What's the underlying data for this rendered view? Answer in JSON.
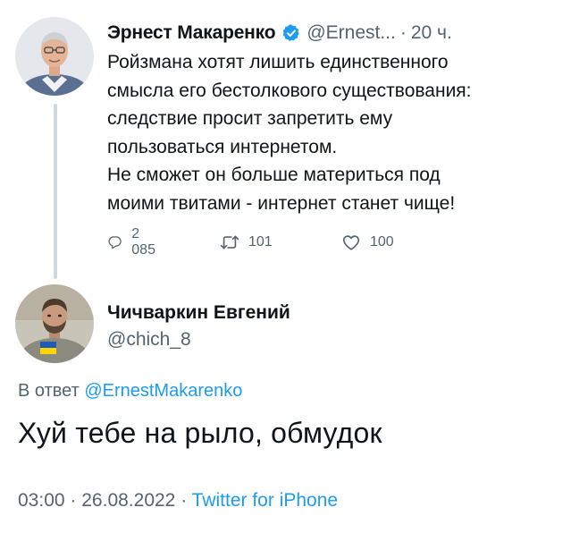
{
  "original_tweet": {
    "author_name": "Эрнест Макаренко",
    "handle": "@Ernest...",
    "separator": "·",
    "time": "20 ч.",
    "lines": [
      "Ройзмана хотят лишить единственного",
      "смысла его бестолкового существования:",
      "следствие просит запретить ему",
      "пользоваться интернетом.",
      "Не сможет он больше материться под",
      "моими твитами - интернет станет чище!"
    ],
    "replies_count": "2 085",
    "retweets_count": "101",
    "likes_count": "100"
  },
  "reply_tweet": {
    "author_name": "Чичваркин Евгений",
    "handle": "@chich_8",
    "reply_to_label": "В ответ",
    "reply_to_mention": "@ErnestMakarenko",
    "text": "Хуй тебе на рыло, обмудок",
    "time": "03:00",
    "separator1": "·",
    "date": "26.08.2022",
    "separator2": "·",
    "source": "Twitter for iPhone"
  },
  "icons": {
    "verified": "verified-badge-icon",
    "reply": "reply-bubble-icon",
    "retweet": "retweet-icon",
    "like": "heart-icon"
  },
  "colors": {
    "text": "#0f1419",
    "secondary": "#536471",
    "link": "#1d9bf0",
    "thread_line": "#cfd9de"
  }
}
